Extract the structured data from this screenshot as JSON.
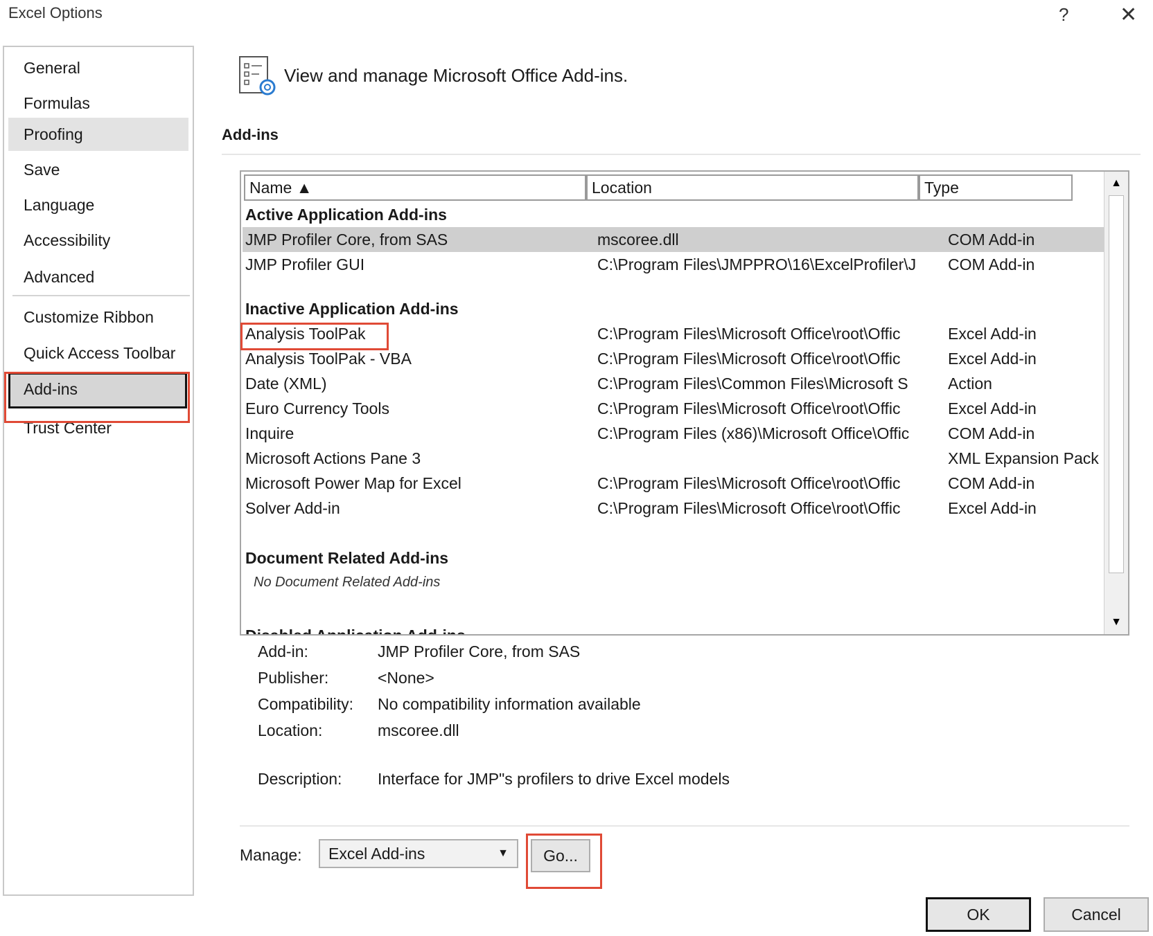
{
  "window": {
    "title": "Excel Options",
    "help": "?",
    "close": "✕"
  },
  "sidebar": {
    "items": [
      {
        "label": "General"
      },
      {
        "label": "Formulas"
      },
      {
        "label": "Proofing"
      },
      {
        "label": "Save"
      },
      {
        "label": "Language"
      },
      {
        "label": "Accessibility"
      },
      {
        "label": "Advanced"
      },
      {
        "label": "Customize Ribbon"
      },
      {
        "label": "Quick Access Toolbar"
      },
      {
        "label": "Add-ins"
      },
      {
        "label": "Trust Center"
      }
    ],
    "selected": "Add-ins",
    "hovered": "Proofing"
  },
  "header": {
    "text": "View and manage Microsoft Office Add-ins."
  },
  "section": {
    "title": "Add-ins"
  },
  "table": {
    "columns": {
      "name": "Name ▲",
      "location": "Location",
      "type": "Type"
    },
    "groups": {
      "active": "Active Application Add-ins",
      "inactive": "Inactive Application Add-ins",
      "document": "Document Related Add-ins",
      "document_empty": "No Document Related Add-ins",
      "disabled_partial": "Disabled Application Add-ins"
    },
    "active_rows": [
      {
        "name": "JMP Profiler Core, from SAS",
        "location": "mscoree.dll",
        "type": "COM Add-in"
      },
      {
        "name": "JMP Profiler GUI",
        "location": "C:\\Program Files\\JMPPRO\\16\\ExcelProfiler\\J",
        "type": "COM Add-in"
      }
    ],
    "inactive_rows": [
      {
        "name": "Analysis ToolPak",
        "location": "C:\\Program Files\\Microsoft Office\\root\\Offic",
        "type": "Excel Add-in"
      },
      {
        "name": "Analysis ToolPak - VBA",
        "location": "C:\\Program Files\\Microsoft Office\\root\\Offic",
        "type": "Excel Add-in"
      },
      {
        "name": "Date (XML)",
        "location": "C:\\Program Files\\Common Files\\Microsoft S",
        "type": "Action"
      },
      {
        "name": "Euro Currency Tools",
        "location": "C:\\Program Files\\Microsoft Office\\root\\Offic",
        "type": "Excel Add-in"
      },
      {
        "name": "Inquire",
        "location": "C:\\Program Files (x86)\\Microsoft Office\\Offic",
        "type": "COM Add-in"
      },
      {
        "name": "Microsoft Actions Pane 3",
        "location": "",
        "type": "XML Expansion Pack"
      },
      {
        "name": "Microsoft Power Map for Excel",
        "location": "C:\\Program Files\\Microsoft Office\\root\\Offic",
        "type": "COM Add-in"
      },
      {
        "name": "Solver Add-in",
        "location": "C:\\Program Files\\Microsoft Office\\root\\Offic",
        "type": "Excel Add-in"
      }
    ]
  },
  "details": {
    "addin_label": "Add-in:",
    "addin_value": "JMP Profiler Core, from SAS",
    "publisher_label": "Publisher:",
    "publisher_value": "<None>",
    "compat_label": "Compatibility:",
    "compat_value": "No compatibility information available",
    "location_label": "Location:",
    "location_value": "mscoree.dll",
    "description_label": "Description:",
    "description_value": "Interface for JMP\"s profilers to drive Excel models"
  },
  "footer": {
    "manage_label": "Manage:",
    "manage_value": "Excel Add-ins",
    "go_label": "Go...",
    "ok_label": "OK",
    "cancel_label": "Cancel"
  },
  "colors": {
    "highlight": "#e04a36",
    "selected_row": "#cfcfcf",
    "nav_selected": "#d6d6d6"
  }
}
